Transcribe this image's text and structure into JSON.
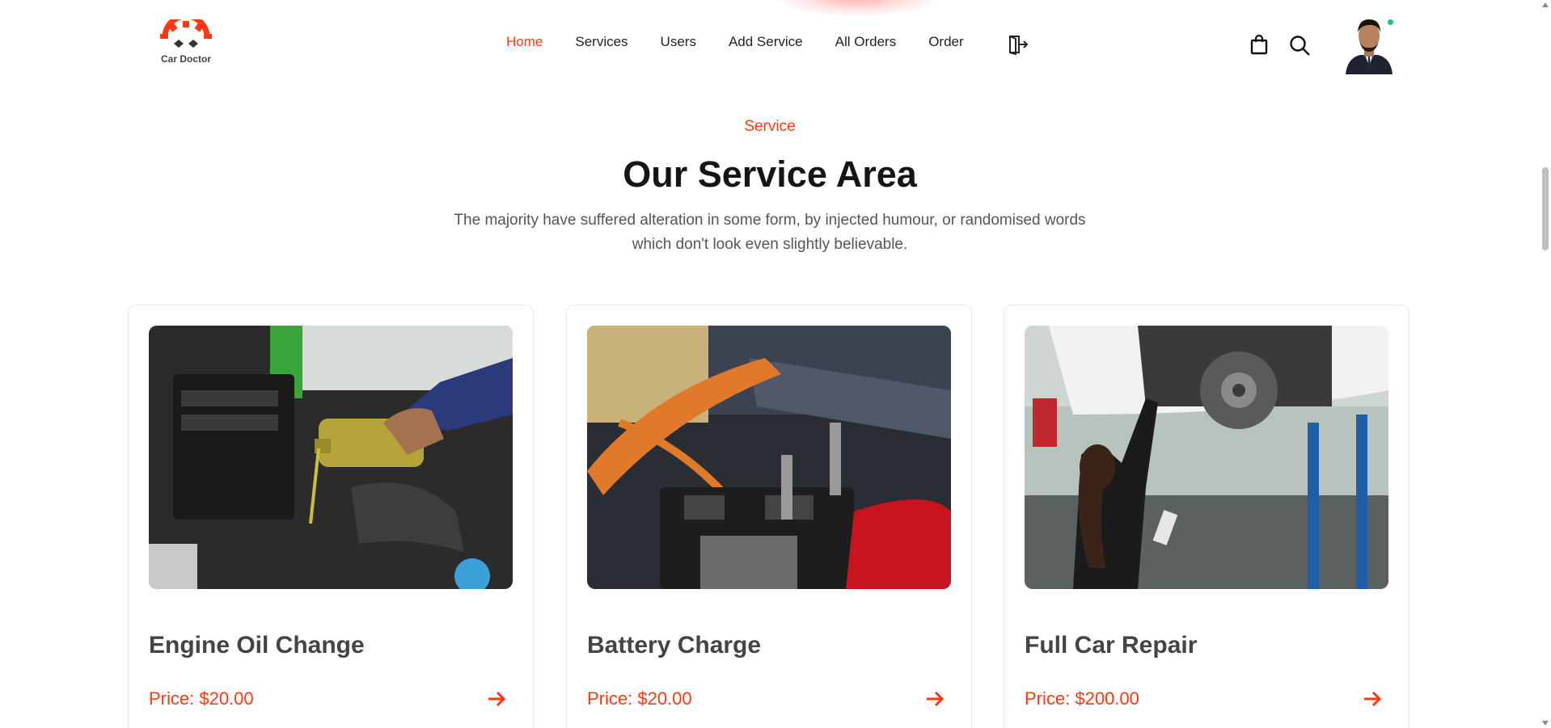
{
  "brand": {
    "name": "Car Doctor",
    "accent_color": "#FF3811"
  },
  "nav": {
    "items": [
      {
        "label": "Home",
        "active": true
      },
      {
        "label": "Services",
        "active": false
      },
      {
        "label": "Users",
        "active": false
      },
      {
        "label": "Add Service",
        "active": false
      },
      {
        "label": "All Orders",
        "active": false
      },
      {
        "label": "Order",
        "active": false
      }
    ],
    "icons": {
      "logout": "logout-icon",
      "cart": "shopping-bag-icon",
      "search": "search-icon",
      "avatar": "user-avatar"
    }
  },
  "section": {
    "tag": "Service",
    "title": "Our Service Area",
    "description": "The majority have suffered alteration in some form, by injected humour, or randomised words which don't look even slightly believable."
  },
  "services": [
    {
      "title": "Engine Oil Change",
      "price": "Price: $20.00",
      "image": "engine-oil-pour-photo"
    },
    {
      "title": "Battery Charge",
      "price": "Price: $20.00",
      "image": "battery-jumper-cables-photo"
    },
    {
      "title": "Full Car Repair",
      "price": "Price: $200.00",
      "image": "mechanic-under-lifted-car-photo"
    }
  ]
}
